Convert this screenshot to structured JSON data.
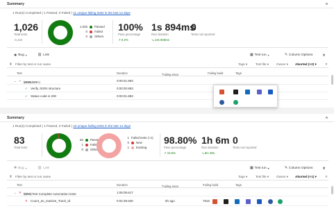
{
  "top": {
    "header": "Summary",
    "summary_prefix": "1 Run(s) Completed ( 1 Passed, 0 Failed ) ",
    "summary_link": "11 unique failing tests in the last 14 days",
    "total_tests": "1,026",
    "total_label": "Total tests",
    "total_trend": "-4,134",
    "donut_values": {
      "passed": 1026,
      "failed": 0,
      "others": 0
    },
    "legend": [
      {
        "count": "1,026",
        "label": "Passed",
        "color": "#107c10"
      },
      {
        "count": "0",
        "label": "Failed",
        "color": "#d13438"
      },
      {
        "count": "0",
        "label": "Others",
        "color": "#a0a0a0"
      }
    ],
    "pass_pct": "100%",
    "pass_label": "Pass percentage",
    "pass_trend": "0.2%",
    "duration": "1s 894ms",
    "duration_label": "Run duration",
    "duration_trend": "13s 606ms",
    "not_reported": "0",
    "not_reported_label": "Tests not reported",
    "toolbar": {
      "bug": "Bug",
      "link": "Link",
      "test_run": "Test run",
      "column_options": "Column Options"
    },
    "filter_placeholder": "Filter by test or run name",
    "filters": {
      "tags": "Tags",
      "test_file": "Test file",
      "owner": "Owner",
      "outcome": "Aborted (+2)"
    },
    "columns": {
      "test": "Test",
      "duration": "Duration",
      "failing_since": "Failing since",
      "failing_build": "Failing build",
      "tags": "Tags"
    },
    "rows": [
      {
        "name": "WMS API",
        "count": "(1026/1026)",
        "duration": "0:00:01.893"
      },
      {
        "name": "Verify JSON structure",
        "count": "",
        "duration": "0:00:00.893"
      },
      {
        "name": "Status code is 200",
        "count": "",
        "duration": "0:00:01.893"
      }
    ]
  },
  "bottom": {
    "header": "Summary",
    "summary_prefix": "1 Run(s) Completed ( 1 Passed, 0 Failed ) ",
    "summary_link": "10 unique failing tests in the last 14 days",
    "total_tests": "83",
    "total_label": "Total tests",
    "total_trend": "",
    "donut_values": {
      "passed": 82,
      "failed": 1,
      "others": 0
    },
    "legend": [
      {
        "count": "82",
        "label": "Passed",
        "color": "#107c10"
      },
      {
        "count": "1",
        "label": "Failed",
        "color": "#d13438"
      },
      {
        "count": "0",
        "label": "Others",
        "color": "#a0a0a0"
      }
    ],
    "failed_donut_values": {
      "new": 0,
      "existing": 1
    },
    "failed_legend": [
      {
        "count": "1",
        "label": "Failed tests (+1)",
        "color": "#d13438"
      },
      {
        "count": "0",
        "label": "New",
        "color": "#d13438"
      },
      {
        "count": "1",
        "label": "Existing",
        "color": "#f4a3a3"
      }
    ],
    "pass_pct": "98.80%",
    "pass_label": "Pass percentage",
    "pass_trend": "10.5%",
    "duration": "1h 6m",
    "duration_label": "Run duration",
    "duration_trend": "5m 39s",
    "not_reported": "0",
    "not_reported_label": "Tests not reported",
    "toolbar": {
      "bug": "Bug",
      "link": "Link",
      "test_run": "Test run",
      "column_options": "Column Options"
    },
    "filter_placeholder": "Filter by test or run name",
    "filters": {
      "tags": "Tags",
      "test_file": "Test file",
      "owner": "Owner",
      "outcome": "Aborted (+1)"
    },
    "columns": {
      "test": "Test",
      "duration": "Duration",
      "failing_since": "Failing since",
      "failing_build": "Failing build",
      "tags": "Tags"
    },
    "rows": [
      {
        "name": "WMS Test Complete Automation tests",
        "count": "(1/83)",
        "duration": "1:06:09.617",
        "failing_since": "",
        "failing_build": ""
      },
      {
        "name": "Count_an_inactive_Track_Id",
        "count": "",
        "duration": "0:02:39.630",
        "failing_since": "6h ago",
        "failing_build": "7816"
      }
    ]
  },
  "taskbar_icons": [
    "powerpoint-icon",
    "terminal-icon",
    "outlook-icon",
    "teams-icon",
    "word-icon",
    "vpn-icon",
    "edge-icon"
  ]
}
